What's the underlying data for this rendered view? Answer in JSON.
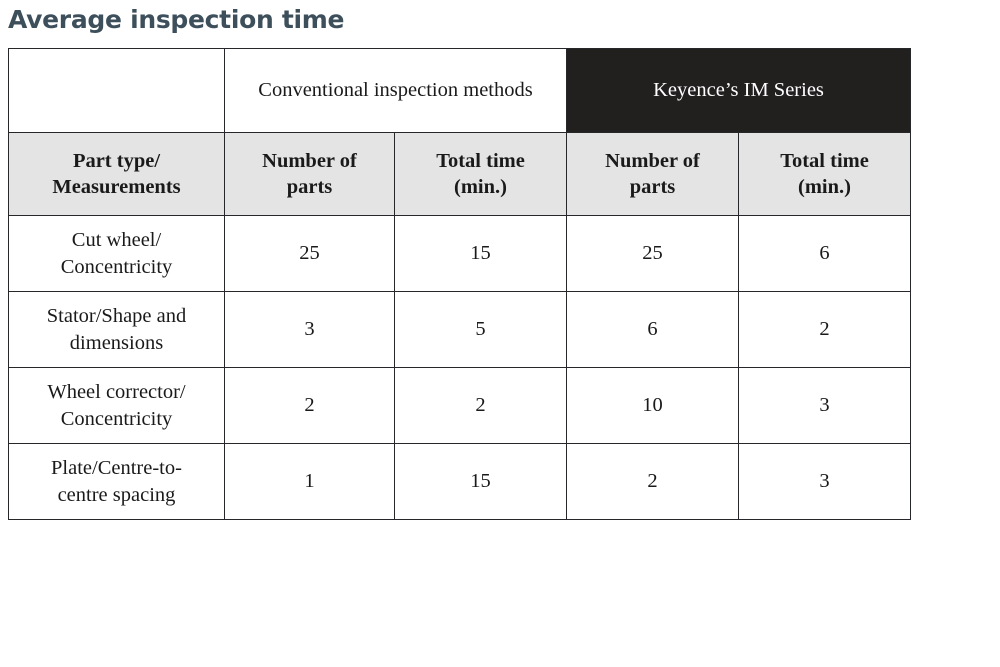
{
  "page": {
    "title": "Average inspection time",
    "title_color": "#3e4f5c",
    "background": "#ffffff"
  },
  "table": {
    "header_dark_bg": "#221f1f",
    "header_dark_text": "#ffffff",
    "subheader_bg": "#e4e4e4",
    "border_color": "#26272a",
    "group_headers": [
      {
        "label": "",
        "span": 1
      },
      {
        "label": "Conventional inspection methods",
        "span": 2
      },
      {
        "label": "Keyence’s IM Series",
        "span": 2
      }
    ],
    "column_headers": [
      "Part type/ Measurements",
      "Number of parts",
      "Total time (min.)",
      "Number of parts",
      "Total time (min.)"
    ],
    "column_header_lines": [
      [
        "Part type/",
        "Measurements"
      ],
      [
        "Number of",
        "parts"
      ],
      [
        "Total time",
        "(min.)"
      ],
      [
        "Number of",
        "parts"
      ],
      [
        "Total time",
        "(min.)"
      ]
    ],
    "rows": [
      {
        "label_lines": [
          "Cut wheel/",
          "Concentricity"
        ],
        "label": "Cut wheel/Concentricity",
        "conventional_parts": "25",
        "conventional_time": "15",
        "keyence_parts": "25",
        "keyence_time": "6"
      },
      {
        "label_lines": [
          "Stator/Shape and",
          "dimensions"
        ],
        "label": "Stator/Shape and dimensions",
        "conventional_parts": "3",
        "conventional_time": "5",
        "keyence_parts": "6",
        "keyence_time": "2"
      },
      {
        "label_lines": [
          "Wheel corrector/",
          "Concentricity"
        ],
        "label": "Wheel corrector/Concentricity",
        "conventional_parts": "2",
        "conventional_time": "2",
        "keyence_parts": "10",
        "keyence_time": "3"
      },
      {
        "label_lines": [
          "Plate/Centre-to-",
          "centre spacing"
        ],
        "label": "Plate/Centre-to-centre spacing",
        "conventional_parts": "1",
        "conventional_time": "15",
        "keyence_parts": "2",
        "keyence_time": "3"
      }
    ]
  },
  "chart_data": {
    "type": "table",
    "title": "Average inspection time",
    "column_groups": [
      "",
      "Conventional inspection methods",
      "Keyence’s IM Series"
    ],
    "columns": [
      "Part type/Measurements",
      "Number of parts",
      "Total time (min.)",
      "Number of parts",
      "Total time (min.)"
    ],
    "rows": [
      [
        "Cut wheel/Concentricity",
        25,
        15,
        25,
        6
      ],
      [
        "Stator/Shape and dimensions",
        3,
        5,
        6,
        2
      ],
      [
        "Wheel corrector/Concentricity",
        2,
        2,
        10,
        3
      ],
      [
        "Plate/Centre-to-centre spacing",
        1,
        15,
        2,
        3
      ]
    ],
    "series": [
      {
        "name": "Conventional inspection methods - Number of parts",
        "values": [
          25,
          3,
          2,
          1
        ]
      },
      {
        "name": "Conventional inspection methods - Total time (min.)",
        "values": [
          15,
          5,
          2,
          15
        ]
      },
      {
        "name": "Keyence’s IM Series - Number of parts",
        "values": [
          25,
          6,
          10,
          2
        ]
      },
      {
        "name": "Keyence’s IM Series - Total time (min.)",
        "values": [
          6,
          2,
          3,
          3
        ]
      }
    ],
    "categories": [
      "Cut wheel/Concentricity",
      "Stator/Shape and dimensions",
      "Wheel corrector/Concentricity",
      "Plate/Centre-to-centre spacing"
    ]
  }
}
